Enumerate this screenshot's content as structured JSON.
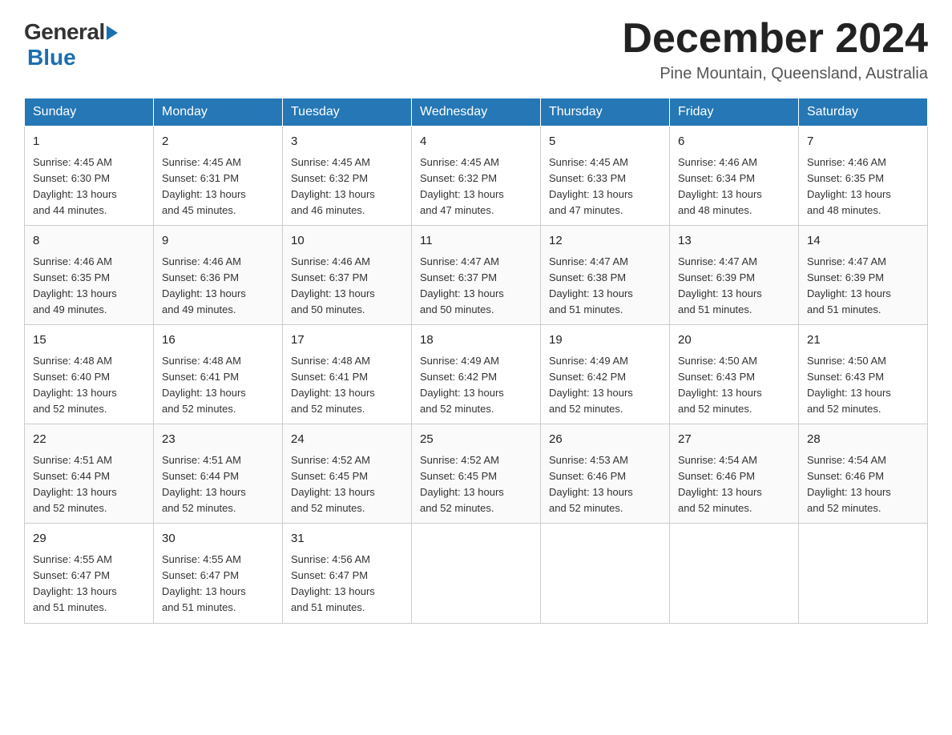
{
  "header": {
    "logo_general": "General",
    "logo_blue": "Blue",
    "month_title": "December 2024",
    "subtitle": "Pine Mountain, Queensland, Australia"
  },
  "days_of_week": [
    "Sunday",
    "Monday",
    "Tuesday",
    "Wednesday",
    "Thursday",
    "Friday",
    "Saturday"
  ],
  "weeks": [
    [
      {
        "day": "1",
        "sunrise": "4:45 AM",
        "sunset": "6:30 PM",
        "daylight": "13 hours and 44 minutes."
      },
      {
        "day": "2",
        "sunrise": "4:45 AM",
        "sunset": "6:31 PM",
        "daylight": "13 hours and 45 minutes."
      },
      {
        "day": "3",
        "sunrise": "4:45 AM",
        "sunset": "6:32 PM",
        "daylight": "13 hours and 46 minutes."
      },
      {
        "day": "4",
        "sunrise": "4:45 AM",
        "sunset": "6:32 PM",
        "daylight": "13 hours and 47 minutes."
      },
      {
        "day": "5",
        "sunrise": "4:45 AM",
        "sunset": "6:33 PM",
        "daylight": "13 hours and 47 minutes."
      },
      {
        "day": "6",
        "sunrise": "4:46 AM",
        "sunset": "6:34 PM",
        "daylight": "13 hours and 48 minutes."
      },
      {
        "day": "7",
        "sunrise": "4:46 AM",
        "sunset": "6:35 PM",
        "daylight": "13 hours and 48 minutes."
      }
    ],
    [
      {
        "day": "8",
        "sunrise": "4:46 AM",
        "sunset": "6:35 PM",
        "daylight": "13 hours and 49 minutes."
      },
      {
        "day": "9",
        "sunrise": "4:46 AM",
        "sunset": "6:36 PM",
        "daylight": "13 hours and 49 minutes."
      },
      {
        "day": "10",
        "sunrise": "4:46 AM",
        "sunset": "6:37 PM",
        "daylight": "13 hours and 50 minutes."
      },
      {
        "day": "11",
        "sunrise": "4:47 AM",
        "sunset": "6:37 PM",
        "daylight": "13 hours and 50 minutes."
      },
      {
        "day": "12",
        "sunrise": "4:47 AM",
        "sunset": "6:38 PM",
        "daylight": "13 hours and 51 minutes."
      },
      {
        "day": "13",
        "sunrise": "4:47 AM",
        "sunset": "6:39 PM",
        "daylight": "13 hours and 51 minutes."
      },
      {
        "day": "14",
        "sunrise": "4:47 AM",
        "sunset": "6:39 PM",
        "daylight": "13 hours and 51 minutes."
      }
    ],
    [
      {
        "day": "15",
        "sunrise": "4:48 AM",
        "sunset": "6:40 PM",
        "daylight": "13 hours and 52 minutes."
      },
      {
        "day": "16",
        "sunrise": "4:48 AM",
        "sunset": "6:41 PM",
        "daylight": "13 hours and 52 minutes."
      },
      {
        "day": "17",
        "sunrise": "4:48 AM",
        "sunset": "6:41 PM",
        "daylight": "13 hours and 52 minutes."
      },
      {
        "day": "18",
        "sunrise": "4:49 AM",
        "sunset": "6:42 PM",
        "daylight": "13 hours and 52 minutes."
      },
      {
        "day": "19",
        "sunrise": "4:49 AM",
        "sunset": "6:42 PM",
        "daylight": "13 hours and 52 minutes."
      },
      {
        "day": "20",
        "sunrise": "4:50 AM",
        "sunset": "6:43 PM",
        "daylight": "13 hours and 52 minutes."
      },
      {
        "day": "21",
        "sunrise": "4:50 AM",
        "sunset": "6:43 PM",
        "daylight": "13 hours and 52 minutes."
      }
    ],
    [
      {
        "day": "22",
        "sunrise": "4:51 AM",
        "sunset": "6:44 PM",
        "daylight": "13 hours and 52 minutes."
      },
      {
        "day": "23",
        "sunrise": "4:51 AM",
        "sunset": "6:44 PM",
        "daylight": "13 hours and 52 minutes."
      },
      {
        "day": "24",
        "sunrise": "4:52 AM",
        "sunset": "6:45 PM",
        "daylight": "13 hours and 52 minutes."
      },
      {
        "day": "25",
        "sunrise": "4:52 AM",
        "sunset": "6:45 PM",
        "daylight": "13 hours and 52 minutes."
      },
      {
        "day": "26",
        "sunrise": "4:53 AM",
        "sunset": "6:46 PM",
        "daylight": "13 hours and 52 minutes."
      },
      {
        "day": "27",
        "sunrise": "4:54 AM",
        "sunset": "6:46 PM",
        "daylight": "13 hours and 52 minutes."
      },
      {
        "day": "28",
        "sunrise": "4:54 AM",
        "sunset": "6:46 PM",
        "daylight": "13 hours and 52 minutes."
      }
    ],
    [
      {
        "day": "29",
        "sunrise": "4:55 AM",
        "sunset": "6:47 PM",
        "daylight": "13 hours and 51 minutes."
      },
      {
        "day": "30",
        "sunrise": "4:55 AM",
        "sunset": "6:47 PM",
        "daylight": "13 hours and 51 minutes."
      },
      {
        "day": "31",
        "sunrise": "4:56 AM",
        "sunset": "6:47 PM",
        "daylight": "13 hours and 51 minutes."
      },
      null,
      null,
      null,
      null
    ]
  ],
  "labels": {
    "sunrise_prefix": "Sunrise: ",
    "sunset_prefix": "Sunset: ",
    "daylight_prefix": "Daylight: "
  }
}
